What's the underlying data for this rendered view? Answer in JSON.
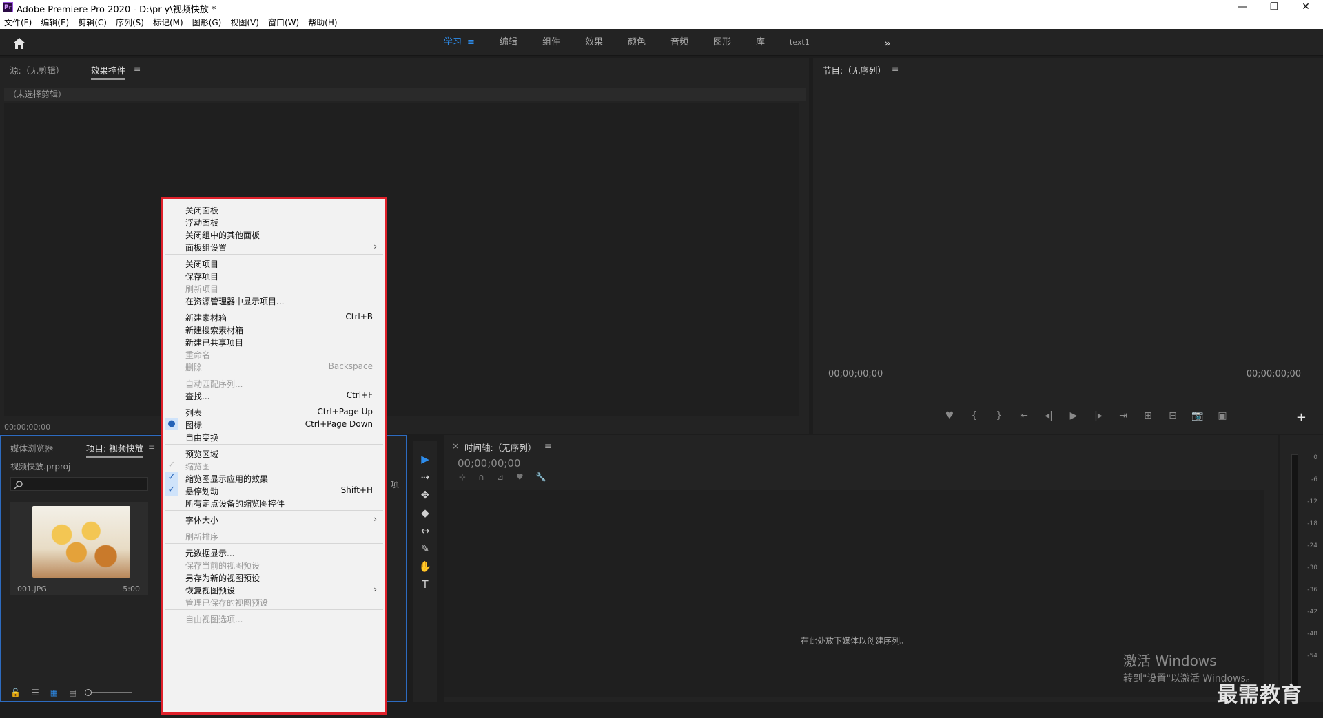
{
  "app": {
    "title": "Adobe Premiere Pro 2020 - D:\\pr y\\视频快放 *",
    "logo": "Pr",
    "window_controls": [
      "—",
      "❐",
      "✕"
    ]
  },
  "menubar": [
    "文件(F)",
    "编辑(E)",
    "剪辑(C)",
    "序列(S)",
    "标记(M)",
    "图形(G)",
    "视图(V)",
    "窗口(W)",
    "帮助(H)"
  ],
  "workspaces": {
    "tabs": [
      {
        "label": "学习",
        "active": true
      },
      {
        "label": "编辑"
      },
      {
        "label": "组件"
      },
      {
        "label": "效果"
      },
      {
        "label": "颜色"
      },
      {
        "label": "音频"
      },
      {
        "label": "图形"
      },
      {
        "label": "库"
      },
      {
        "label": "text1"
      }
    ],
    "menu_icon": "≡",
    "more_icon": "»",
    "accent_color": "#2d8ceb"
  },
  "effect_panel": {
    "tab_source": "源:（无剪辑）",
    "tab_effects": "效果控件",
    "menu_icon": "≡",
    "no_clip": "（未选择剪辑）",
    "timecode": "00;00;00;00"
  },
  "program_panel": {
    "tab": "节目:（无序列）",
    "menu_icon": "≡",
    "timecode_left": "00;00;00;00",
    "timecode_right": "00;00;00;00",
    "controls": [
      "♥",
      "{",
      "}",
      "⇤",
      "◂|",
      "▶",
      "|▸",
      "⇥",
      "⊞",
      "⊟",
      "📷",
      "▣"
    ],
    "add_icon": "+"
  },
  "project_panel": {
    "tab_media": "媒体浏览器",
    "tab_project": "项目: 视频快放",
    "menu_icon": "≡",
    "project_file": "视频快放.prproj",
    "clip_name": "001.JPG",
    "clip_duration": "5:00",
    "overflow_label": "项",
    "footer_icons": [
      "🔓",
      "☰",
      "▦",
      "▤"
    ]
  },
  "tools": [
    "▶",
    "⇢",
    "✥",
    "◆",
    "↔",
    "✎",
    "✋",
    "T"
  ],
  "timeline_panel": {
    "close_icon": "×",
    "tab": "时间轴:（无序列）",
    "menu_icon": "≡",
    "timecode": "00;00;00;00",
    "icons": [
      "⊹",
      "∩",
      "⊿",
      "♥",
      "🔧"
    ],
    "drop_message": "在此处放下媒体以创建序列。"
  },
  "audio_meter": {
    "scale": [
      "0",
      "-6",
      "-12",
      "-18",
      "-24",
      "-30",
      "-36",
      "-42",
      "-48",
      "-54"
    ]
  },
  "watermark": {
    "line1": "激活 Windows",
    "line2": "转到\"设置\"以激活 Windows。",
    "brand": "最需教育"
  },
  "context_menu": {
    "border_color": "#e0212b",
    "items": [
      {
        "label": "关闭面板"
      },
      {
        "label": "浮动面板"
      },
      {
        "label": "关闭组中的其他面板"
      },
      {
        "label": "面板组设置",
        "submenu": true
      },
      {
        "sep": true
      },
      {
        "label": "关闭项目"
      },
      {
        "label": "保存项目"
      },
      {
        "label": "刷新项目",
        "disabled": true
      },
      {
        "label": "在资源管理器中显示项目..."
      },
      {
        "sep": true
      },
      {
        "label": "新建素材箱",
        "shortcut": "Ctrl+B"
      },
      {
        "label": "新建搜索素材箱"
      },
      {
        "label": "新建已共享项目"
      },
      {
        "label": "重命名",
        "disabled": true
      },
      {
        "label": "删除",
        "shortcut": "Backspace",
        "disabled": true
      },
      {
        "sep": true
      },
      {
        "label": "自动匹配序列...",
        "disabled": true
      },
      {
        "label": "查找...",
        "shortcut": "Ctrl+F"
      },
      {
        "sep": true
      },
      {
        "label": "列表",
        "shortcut": "Ctrl+Page Up"
      },
      {
        "label": "图标",
        "shortcut": "Ctrl+Page Down",
        "mark": "●"
      },
      {
        "label": "自由变换"
      },
      {
        "sep": true
      },
      {
        "label": "预览区域"
      },
      {
        "label": "缩览图",
        "disabled": true,
        "mark": "✓",
        "mark_disabled": true
      },
      {
        "label": "缩览图显示应用的效果",
        "mark": "✓"
      },
      {
        "label": "悬停划动",
        "shortcut": "Shift+H",
        "mark": "✓"
      },
      {
        "label": "所有定点设备的缩览图控件"
      },
      {
        "sep": true
      },
      {
        "label": "字体大小",
        "submenu": true
      },
      {
        "sep": true
      },
      {
        "label": "刷新排序",
        "disabled": true
      },
      {
        "sep": true
      },
      {
        "label": "元数据显示..."
      },
      {
        "label": "保存当前的视图预设",
        "disabled": true
      },
      {
        "label": "另存为新的视图预设"
      },
      {
        "label": "恢复视图预设",
        "submenu": true
      },
      {
        "label": "管理已保存的视图预设",
        "disabled": true
      },
      {
        "sep": true
      },
      {
        "label": "自由视图选项...",
        "disabled": true
      }
    ]
  }
}
